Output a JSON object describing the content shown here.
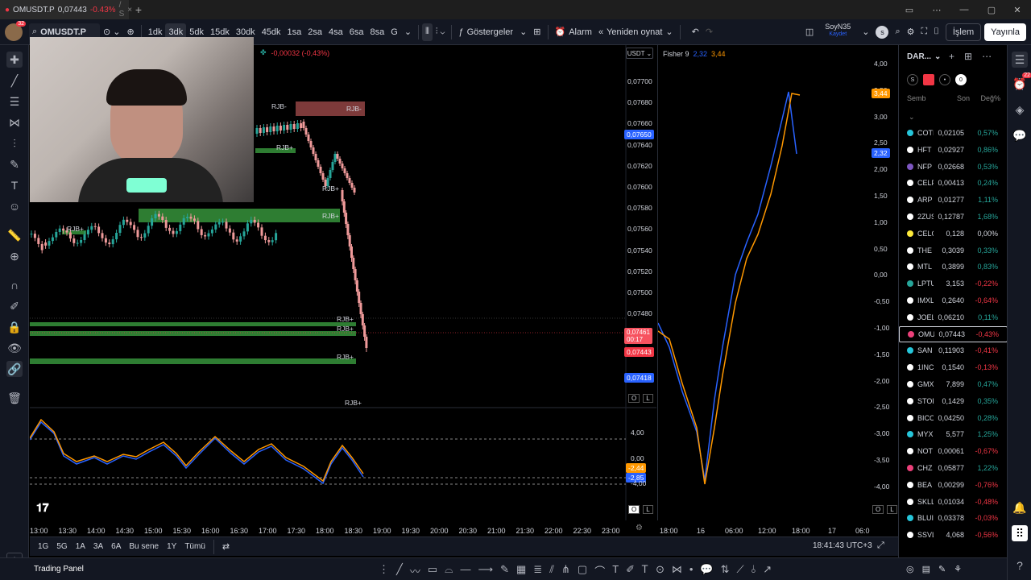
{
  "tab": {
    "title": "OMUSDT.P",
    "price": "0,07443",
    "change": "-0.43%",
    "suffix": "/ S"
  },
  "toolbar": {
    "symbol": "OMUSDT.P",
    "intervals": [
      "1dk",
      "3dk",
      "5dk",
      "15dk",
      "30dk",
      "45dk",
      "1sa",
      "2sa",
      "4sa",
      "6sa",
      "8sa",
      "G"
    ],
    "active_interval": "3dk",
    "indicators": "Göstergeler",
    "alarm": "Alarm",
    "replay": "Yeniden oynat",
    "layout_name": "SoyN35",
    "layout_sub": "Kaydet",
    "trade": "İşlem",
    "publish": "Yayınla"
  },
  "main_chart": {
    "change_text": "-0,00032 (-0,43%)",
    "currency": "USDT",
    "price_axis": [
      "0,07700",
      "0,07680",
      "0,07660",
      "0,07640",
      "0,07620",
      "0,07600",
      "0,07580",
      "0,07560",
      "0,07540",
      "0,07520",
      "0,07500",
      "0,07480"
    ],
    "badges": {
      "blue_top": "0,07650",
      "red_now": "0,07461",
      "countdown": "00:17",
      "red_last": "0,07443",
      "blue_bottom": "0,07418"
    },
    "labels": {
      "rjb_minus": "RJB-",
      "rjb_plus": "RJB+"
    },
    "osc_axis": {
      "top": "4,00",
      "mid": "0,00",
      "bot": "-4,00"
    },
    "osc_badges": {
      "orange": "-2,44",
      "blue": "-2,85"
    },
    "time_axis": [
      "13:00",
      "13:30",
      "14:00",
      "14:30",
      "15:00",
      "15:30",
      "16:00",
      "16:30",
      "17:00",
      "17:30",
      "18:00",
      "18:30",
      "19:00",
      "19:30",
      "20:00",
      "20:30",
      "21:00",
      "21:30",
      "22:00",
      "22:30",
      "23:00"
    ]
  },
  "fisher": {
    "title": "Fisher 9",
    "val1": "2,32",
    "val2": "3,44",
    "axis": [
      "4,00",
      "3,50",
      "3,00",
      "2,50",
      "2,00",
      "1,50",
      "1,00",
      "0,50",
      "0,00",
      "-0,50",
      "-1,00",
      "-1,50",
      "-2,00",
      "-2,50",
      "-3,00",
      "-3,50",
      "-4,00"
    ],
    "badge_orange": "3,44",
    "badge_blue": "2,32",
    "time_axis": [
      "18:00",
      "16",
      "06:00",
      "12:00",
      "18:00",
      "17",
      "06:0"
    ],
    "clock": "18:41:43 UTC+3"
  },
  "watchlist": {
    "title": "DAR...",
    "headers": {
      "symbol": "Semb",
      "last": "Son",
      "change": "Değ%"
    },
    "rows": [
      {
        "sym": "COTI",
        "last": "0,02105",
        "chg": "0,57%",
        "dir": "pos",
        "color": "#26c6da"
      },
      {
        "sym": "HFT",
        "last": "0,02927",
        "chg": "0,86%",
        "dir": "pos",
        "color": "#ffffff"
      },
      {
        "sym": "NFP",
        "last": "0,02668",
        "chg": "0,53%",
        "dir": "pos",
        "color": "#7e57c2"
      },
      {
        "sym": "CELF",
        "last": "0,00413",
        "chg": "0,24%",
        "dir": "pos",
        "color": "#ffffff"
      },
      {
        "sym": "ARP",
        "last": "0,01277",
        "chg": "1,11%",
        "dir": "pos",
        "color": "#ffffff"
      },
      {
        "sym": "2ZUS",
        "last": "0,12787",
        "chg": "1,68%",
        "dir": "pos",
        "color": "#ffffff"
      },
      {
        "sym": "CELO",
        "last": "0,128",
        "chg": "0,00%",
        "dir": "neu",
        "color": "#ffeb3b"
      },
      {
        "sym": "THE",
        "last": "0,3039",
        "chg": "0,33%",
        "dir": "pos",
        "color": "#ffffff"
      },
      {
        "sym": "MTL",
        "last": "0,3899",
        "chg": "0,83%",
        "dir": "pos",
        "color": "#ffffff"
      },
      {
        "sym": "LPTU",
        "last": "3,153",
        "chg": "-0,22%",
        "dir": "neg",
        "color": "#26a69a"
      },
      {
        "sym": "IMXL",
        "last": "0,2640",
        "chg": "-0,64%",
        "dir": "neg",
        "color": "#ffffff"
      },
      {
        "sym": "JOEL",
        "last": "0,06210",
        "chg": "0,11%",
        "dir": "pos",
        "color": "#ffffff"
      },
      {
        "sym": "OMU",
        "last": "0,07443",
        "chg": "-0,43%",
        "dir": "neg",
        "color": "#ec407a"
      },
      {
        "sym": "SAN",
        "last": "0,11903",
        "chg": "-0,41%",
        "dir": "neg",
        "color": "#26c6da"
      },
      {
        "sym": "1INC",
        "last": "0,1540",
        "chg": "-0,13%",
        "dir": "neg",
        "color": "#ffffff"
      },
      {
        "sym": "GMX",
        "last": "7,899",
        "chg": "0,47%",
        "dir": "pos",
        "color": "#ffffff"
      },
      {
        "sym": "STOF",
        "last": "0,1429",
        "chg": "0,35%",
        "dir": "pos",
        "color": "#ffffff"
      },
      {
        "sym": "BICO",
        "last": "0,04250",
        "chg": "0,28%",
        "dir": "pos",
        "color": "#ffffff"
      },
      {
        "sym": "MYX",
        "last": "5,577",
        "chg": "1,25%",
        "dir": "pos",
        "color": "#26c6da"
      },
      {
        "sym": "NOT",
        "last": "0,00061",
        "chg": "-0,67%",
        "dir": "neg",
        "color": "#ffffff"
      },
      {
        "sym": "CHZ",
        "last": "0,05877",
        "chg": "1,22%",
        "dir": "pos",
        "color": "#ec407a"
      },
      {
        "sym": "BEA",
        "last": "0,00299",
        "chg": "-0,76%",
        "dir": "neg",
        "color": "#ffffff"
      },
      {
        "sym": "SKLL",
        "last": "0,01034",
        "chg": "-0,48%",
        "dir": "neg",
        "color": "#ffffff"
      },
      {
        "sym": "BLUI",
        "last": "0,03378",
        "chg": "-0,03%",
        "dir": "neg",
        "color": "#26c6da"
      },
      {
        "sym": "SSVL",
        "last": "4,068",
        "chg": "-0,56%",
        "dir": "neg",
        "color": "#ffffff"
      }
    ]
  },
  "bottom": {
    "ranges": [
      "1G",
      "5G",
      "1A",
      "3A",
      "6A",
      "Bu sene",
      "1Y",
      "Tümü"
    ],
    "trading_panel": "Trading Panel"
  },
  "notif_count": "22"
}
